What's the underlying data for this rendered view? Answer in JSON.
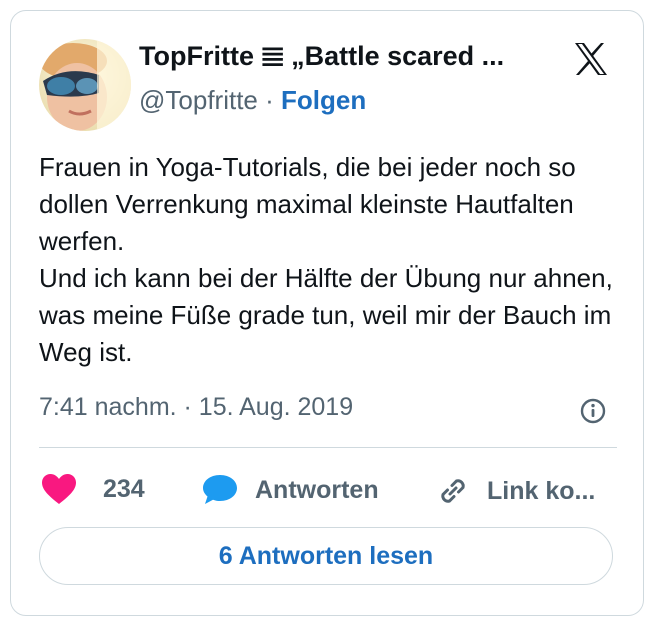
{
  "author": {
    "display_name": "TopFritte",
    "name_suffix": "„Battle scared ...",
    "handle": "@Topfritte",
    "separator": "·",
    "follow_label": "Folgen"
  },
  "tweet": {
    "text": "Frauen in Yoga-Tutorials, die bei jeder noch so dollen Verrenkung maximal kleinste Hautfalten werfen.\nUnd ich kann bei der Hälfte der Übung nur ahnen, was meine Füße grade tun, weil mir der Bauch im Weg ist.",
    "timestamp": "7:41 nachm. · 15. Aug. 2019"
  },
  "actions": {
    "likes": "234",
    "reply_label": "Antworten",
    "copy_link_label": "Link ko..."
  },
  "read_replies_label": "6 Antworten lesen",
  "colors": {
    "like": "#f91880",
    "reply": "#1d9bf0",
    "link": "#1d6ebf",
    "muted": "#536471",
    "border": "#cfd9de"
  },
  "icons": [
    "x-logo-icon",
    "info-icon",
    "heart-icon",
    "speech-bubble-icon",
    "link-icon",
    "menu-lines-icon"
  ]
}
